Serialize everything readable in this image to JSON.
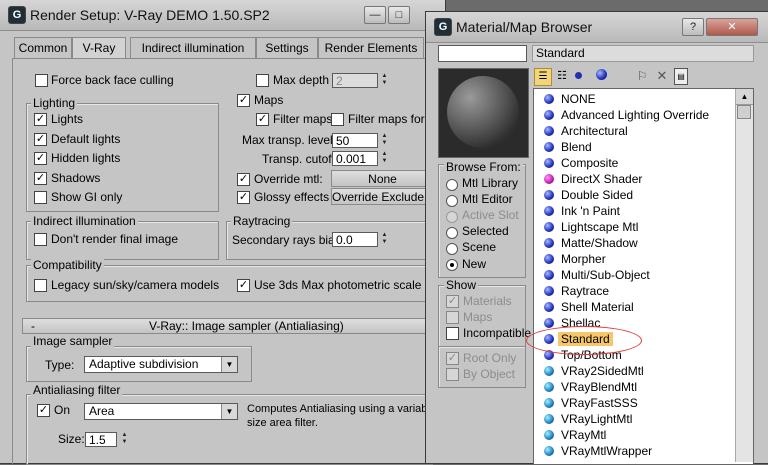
{
  "render_setup": {
    "title": "Render Setup: V-Ray DEMO 1.50.SP2",
    "tabs": [
      "Common",
      "V-Ray",
      "Indirect illumination",
      "Settings",
      "Render Elements"
    ],
    "force_back_face_culling": "Force back face culling",
    "lighting": {
      "title": "Lighting",
      "items": [
        "Lights",
        "Default lights",
        "Hidden lights",
        "Shadows",
        "Show GI only"
      ]
    },
    "right_top": {
      "max_depth_label": "Max depth",
      "max_depth_value": "2",
      "maps_label": "Maps",
      "filter_maps_label": "Filter maps",
      "filter_maps_gi_label": "Filter maps for GI",
      "max_transp_label": "Max transp. levels",
      "max_transp_value": "50",
      "transp_cutoff_label": "Transp. cutoff",
      "transp_cutoff_value": "0.001",
      "override_mtl_label": "Override mtl:",
      "override_mtl_value": "None",
      "glossy_label": "Glossy effects",
      "override_exclude": "Override Exclude..."
    },
    "indirect": {
      "title": "Indirect illumination",
      "dont_render": "Don't render final image"
    },
    "raytracing": {
      "title": "Raytracing",
      "bias_label": "Secondary rays bias",
      "bias_value": "0.0"
    },
    "compat": {
      "title": "Compatibility",
      "legacy": "Legacy sun/sky/camera models",
      "photometric": "Use 3ds Max photometric scale"
    },
    "image_sampler_rollout": {
      "collapse": "-",
      "title": "V-Ray:: Image sampler (Antialiasing)"
    },
    "image_sampler": {
      "title": "Image sampler",
      "type_label": "Type:",
      "type_value": "Adaptive subdivision"
    },
    "aa_filter": {
      "title": "Antialiasing filter",
      "on_label": "On",
      "filter_value": "Area",
      "description": "Computes Antialiasing using a variable size area filter.",
      "size_label": "Size:",
      "size_value": "1.5"
    }
  },
  "browser": {
    "title": "Material/Map Browser",
    "name_field": "",
    "selected_name": "Standard",
    "browse_from": {
      "title": "Browse From:",
      "options": [
        "Mtl Library",
        "Mtl Editor",
        "Active Slot",
        "Selected",
        "Scene",
        "New"
      ]
    },
    "show": {
      "title": "Show",
      "options": [
        "Materials",
        "Maps",
        "Incompatible"
      ]
    },
    "root_only": "Root Only",
    "by_object": "By Object",
    "list": [
      "NONE",
      "Advanced Lighting Override",
      "Architectural",
      "Blend",
      "Composite",
      "DirectX Shader",
      "Double Sided",
      "Ink 'n Paint",
      "Lightscape Mtl",
      "Matte/Shadow",
      "Morpher",
      "Multi/Sub-Object",
      "Raytrace",
      "Shell Material",
      "Shellac",
      "Standard",
      "Top/Bottom",
      "VRay2SidedMtl",
      "VRayBlendMtl",
      "VRayFastSSS",
      "VRayLightMtl",
      "VRayMtl",
      "VRayMtlWrapper"
    ],
    "highlight_color": "#f6c76a",
    "annotation_color": "#e23a3a"
  },
  "icons": {
    "app": "G",
    "minimize": "—",
    "maximize": "□",
    "close": "✕",
    "help": "?"
  }
}
